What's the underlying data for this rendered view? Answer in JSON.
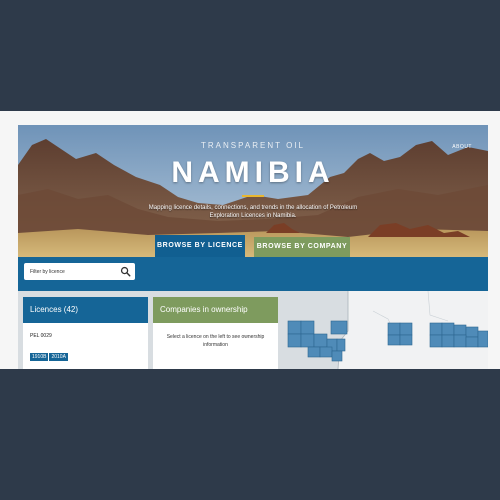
{
  "header": {
    "kicker": "TRANSPARENT OIL",
    "title": "NAMIBIA",
    "subtitle": "Mapping licence details, connections, and trends in the allocation of Petroleum Exploration Licences in Namibia.",
    "about_label": "ABOUT"
  },
  "tabs": [
    {
      "label": "BROWSE BY LICENCE",
      "active": true,
      "color": "#115f91"
    },
    {
      "label": "BROWSE BY COMPANY",
      "active": false,
      "color": "#7e9b5e"
    }
  ],
  "filter": {
    "placeholder": "Filter by licence"
  },
  "licences": {
    "heading": "Licences (42)",
    "items": [
      {
        "name": "PEL 0029",
        "tags": [
          "1910B",
          "2010A"
        ]
      }
    ]
  },
  "companies": {
    "heading": "Companies in ownership",
    "message": "Select a licence on the left to see ownership information"
  },
  "colors": {
    "primary": "#156597",
    "secondary": "#7e9b5e",
    "accent": "#e8b730",
    "background": "#2e3a4a"
  }
}
